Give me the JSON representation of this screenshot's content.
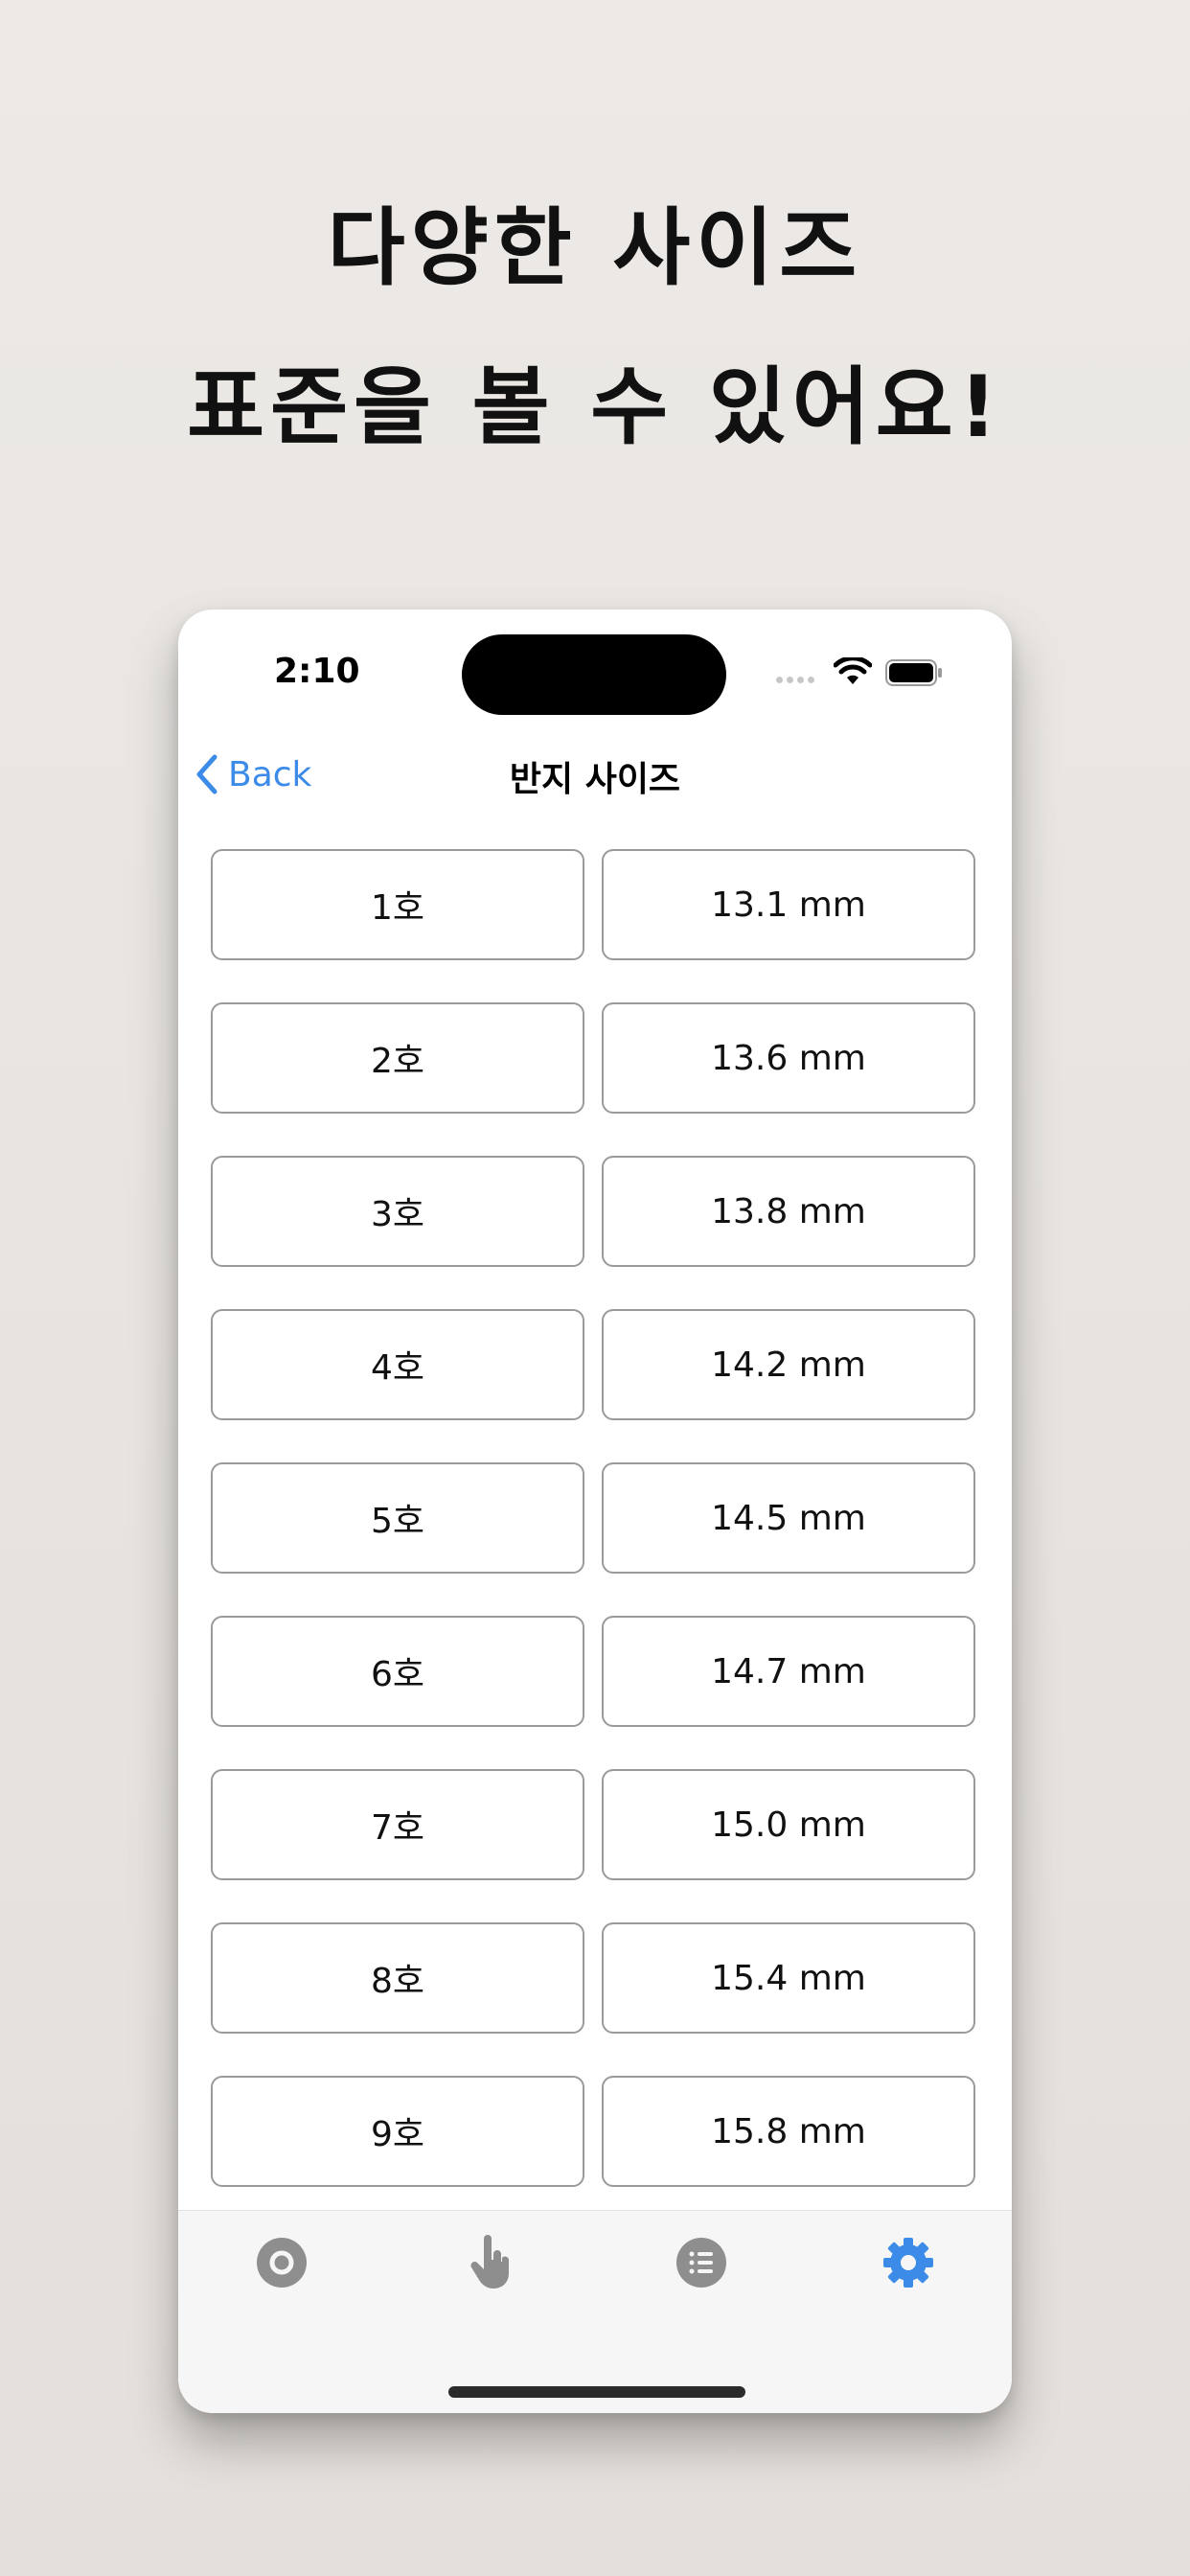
{
  "headline": {
    "line1": "다양한 사이즈",
    "line2": "표준을 볼 수 있어요!"
  },
  "status_bar": {
    "time": "2:10"
  },
  "nav": {
    "back_label": "Back",
    "title": "반지 사이즈"
  },
  "sizes": [
    {
      "size": "1호",
      "diameter": "13.1 mm"
    },
    {
      "size": "2호",
      "diameter": "13.6 mm"
    },
    {
      "size": "3호",
      "diameter": "13.8 mm"
    },
    {
      "size": "4호",
      "diameter": "14.2 mm"
    },
    {
      "size": "5호",
      "diameter": "14.5 mm"
    },
    {
      "size": "6호",
      "diameter": "14.7 mm"
    },
    {
      "size": "7호",
      "diameter": "15.0 mm"
    },
    {
      "size": "8호",
      "diameter": "15.4 mm"
    },
    {
      "size": "9호",
      "diameter": "15.8 mm"
    }
  ],
  "tabbar": {
    "tabs": [
      {
        "icon": "ring-icon",
        "selected": false
      },
      {
        "icon": "hand-pointer-icon",
        "selected": false
      },
      {
        "icon": "list-icon",
        "selected": false
      },
      {
        "icon": "gear-icon",
        "selected": true
      }
    ],
    "colors": {
      "active": "#3c8be8",
      "inactive": "#8e8e8e"
    }
  },
  "colors": {
    "accent": "#3c8be8",
    "background": "#e8e5e2"
  }
}
